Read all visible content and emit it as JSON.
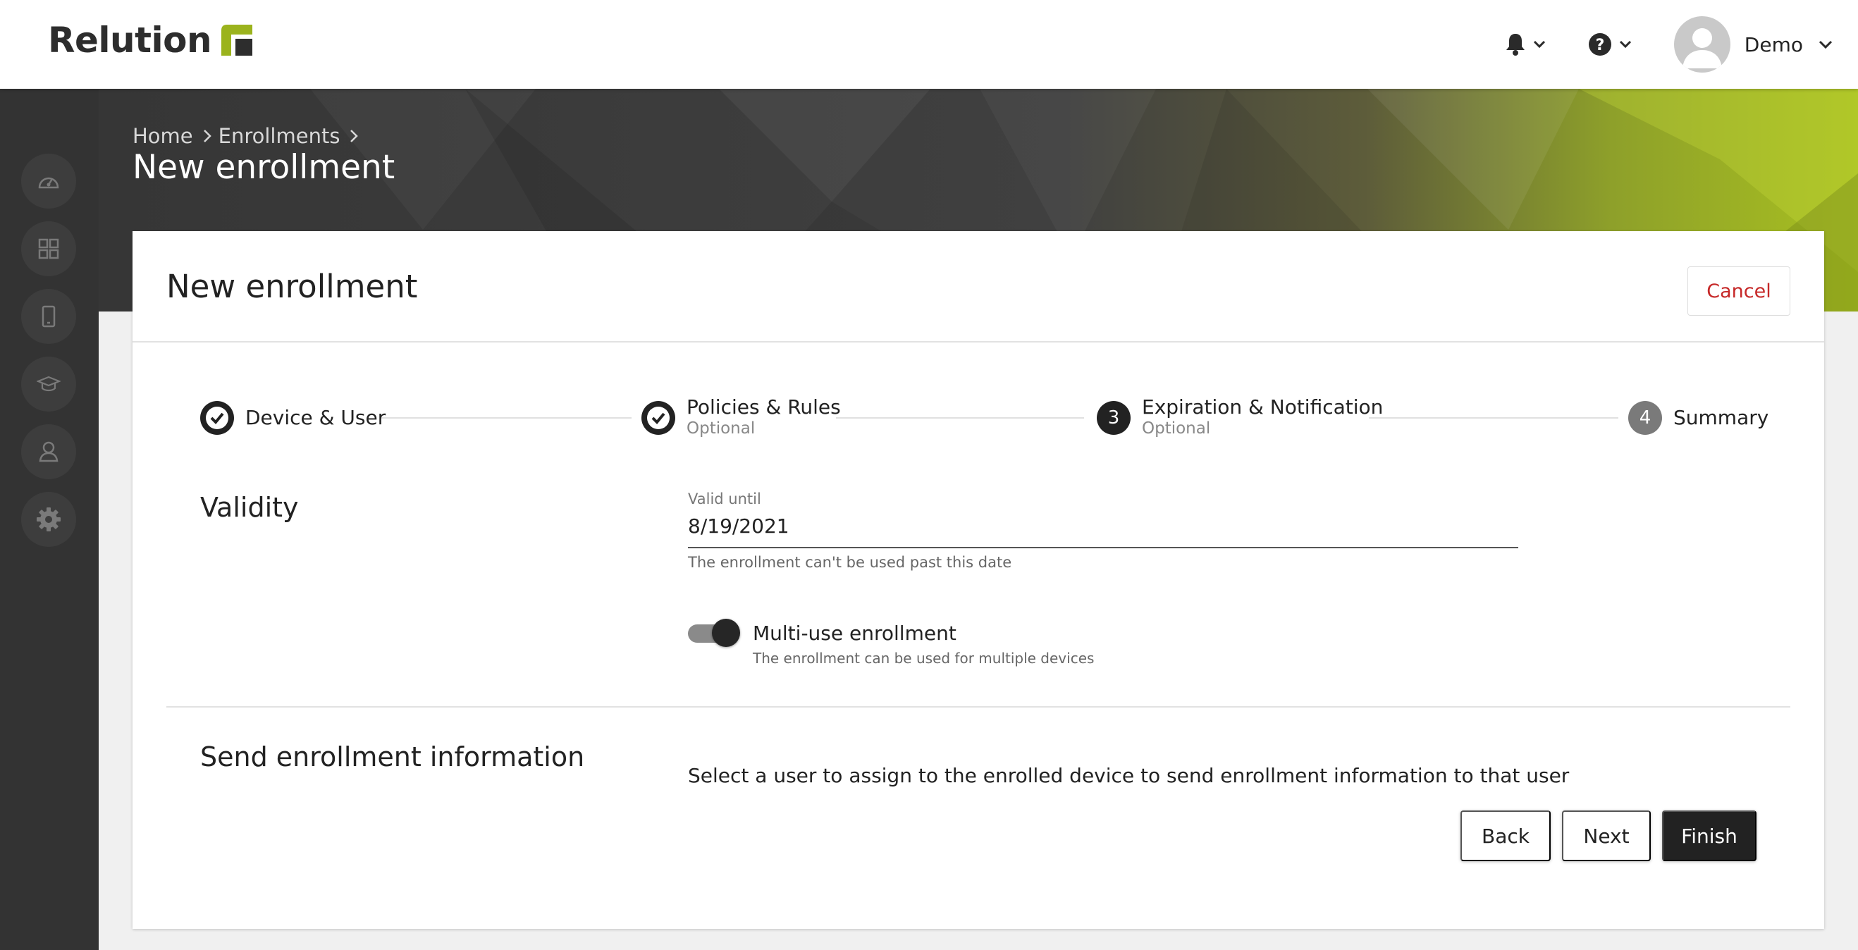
{
  "app": {
    "name": "Relution",
    "brand_color": "#9bb31d"
  },
  "topbar": {
    "notifications_icon": "bell-icon",
    "help_icon": "help-circle-icon",
    "user_name": "Demo"
  },
  "sidebar": {
    "items": [
      {
        "icon": "dashboard-icon"
      },
      {
        "icon": "apps-grid-icon"
      },
      {
        "icon": "device-icon"
      },
      {
        "icon": "education-icon"
      },
      {
        "icon": "user-icon"
      },
      {
        "icon": "gear-icon"
      }
    ]
  },
  "breadcrumb": {
    "items": [
      "Home",
      "Enrollments"
    ]
  },
  "page": {
    "title": "New enrollment"
  },
  "card": {
    "title": "New enrollment",
    "cancel_label": "Cancel"
  },
  "stepper": {
    "steps": [
      {
        "label": "Device & User",
        "subtitle": "",
        "state": "done"
      },
      {
        "label": "Policies & Rules",
        "subtitle": "Optional",
        "state": "done"
      },
      {
        "number": "3",
        "label": "Expiration & Notification",
        "subtitle": "Optional",
        "state": "active"
      },
      {
        "number": "4",
        "label": "Summary",
        "subtitle": "",
        "state": "pending"
      }
    ]
  },
  "validity": {
    "title": "Validity",
    "field_label": "Valid until",
    "field_value": "8/19/2021",
    "field_hint": "The enrollment can't be used past this date",
    "multi_use_label": "Multi-use enrollment",
    "multi_use_hint": "The enrollment can be used for multiple devices",
    "multi_use_enabled": true
  },
  "send_info": {
    "title": "Send enrollment information",
    "description": "Select a user to assign to the enrolled device to send enrollment information to that user"
  },
  "actions": {
    "back": "Back",
    "next": "Next",
    "finish": "Finish"
  }
}
